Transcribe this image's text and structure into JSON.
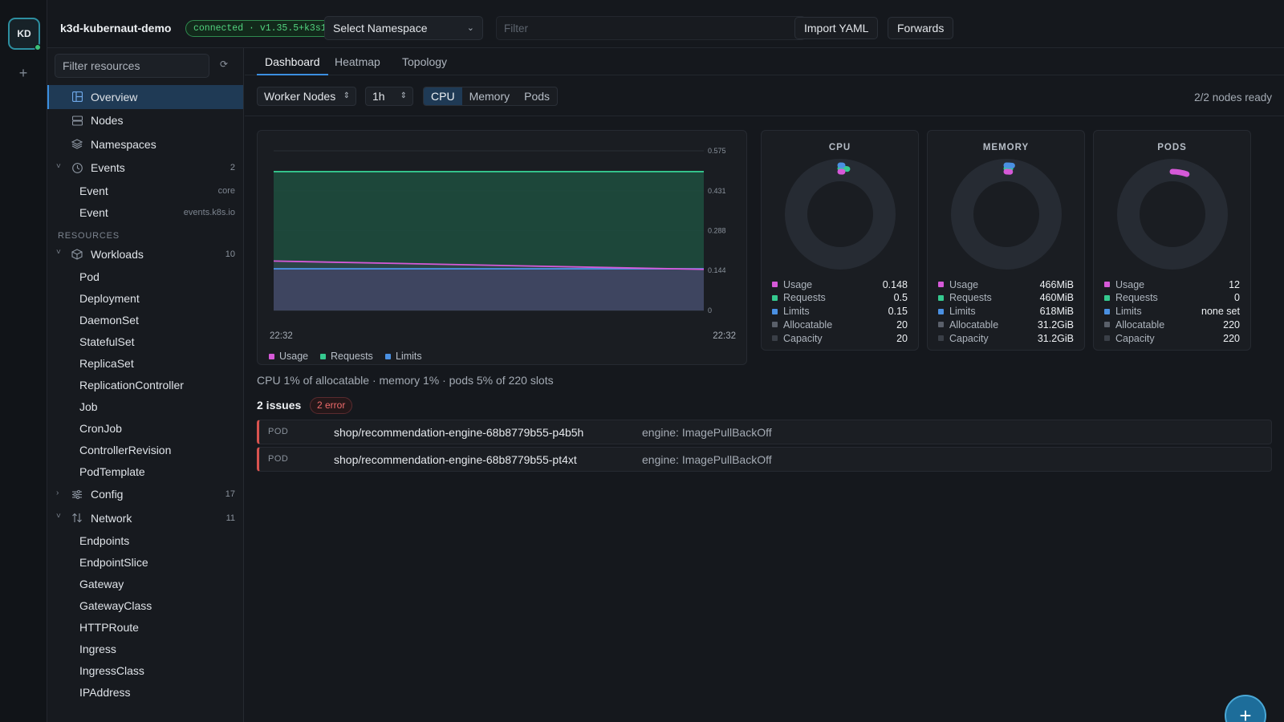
{
  "window": {
    "controls": [
      "close",
      "minimize",
      "maximize"
    ]
  },
  "rail": {
    "avatar_initials": "KD",
    "add_label": "+"
  },
  "topbar": {
    "cluster_name": "k3d-kubernaut-demo",
    "status_badge": "connected · v1.35.5+k3s1",
    "namespace_select": "Select Namespace",
    "filter_placeholder": "Filter",
    "import_label": "Import YAML",
    "forwards_label": "Forwards"
  },
  "sidebar": {
    "filter_placeholder": "Filter resources",
    "refresh_icon": "refresh-icon",
    "items": [
      {
        "label": "Overview",
        "icon": "grid-icon",
        "active": true
      },
      {
        "label": "Nodes",
        "icon": "server-icon"
      },
      {
        "label": "Namespaces",
        "icon": "layers-icon"
      },
      {
        "label": "Events",
        "icon": "clock-icon",
        "count": "2",
        "expanded": true,
        "children": [
          {
            "label": "Event",
            "tag": "core"
          },
          {
            "label": "Event",
            "tag": "events.k8s.io"
          }
        ]
      }
    ],
    "section_label": "RESOURCES",
    "groups": [
      {
        "label": "Workloads",
        "icon": "cube-icon",
        "count": "10",
        "expanded": true,
        "children": [
          "Pod",
          "Deployment",
          "DaemonSet",
          "StatefulSet",
          "ReplicaSet",
          "ReplicationController",
          "Job",
          "CronJob",
          "ControllerRevision",
          "PodTemplate"
        ]
      },
      {
        "label": "Config",
        "icon": "sliders-icon",
        "count": "17",
        "expanded": false,
        "children": []
      },
      {
        "label": "Network",
        "icon": "arrows-icon",
        "count": "11",
        "expanded": true,
        "children": [
          "Endpoints",
          "EndpointSlice",
          "Gateway",
          "GatewayClass",
          "HTTPRoute",
          "Ingress",
          "IngressClass",
          "IPAddress"
        ]
      }
    ]
  },
  "tabs": [
    "Dashboard",
    "Heatmap",
    "Topology"
  ],
  "active_tab": "Dashboard",
  "toolbar": {
    "node_select": "Worker Nodes",
    "range_select": "1h",
    "metric_tabs": [
      "CPU",
      "Memory",
      "Pods"
    ],
    "active_metric": "CPU",
    "ready_status": "2/2 nodes ready"
  },
  "colors": {
    "usage": "#d659d8",
    "requests": "#35c98f",
    "limits": "#4a90e2",
    "allocatable": "#5a606a",
    "capacity": "#3a3f47",
    "accent": "#3b8fe0",
    "error": "#d9534f"
  },
  "chart_data": {
    "type": "area",
    "x": [
      "22:32",
      "22:32"
    ],
    "ylim": [
      0,
      0.575
    ],
    "yticks": [
      "0",
      "0.144",
      "0.288",
      "0.431",
      "0.575"
    ],
    "series": [
      {
        "name": "Usage",
        "values": [
          0.178,
          0.148
        ]
      },
      {
        "name": "Requests",
        "values": [
          0.5,
          0.5
        ]
      },
      {
        "name": "Limits",
        "values": [
          0.15,
          0.15
        ]
      }
    ],
    "legend": [
      "Usage",
      "Requests",
      "Limits"
    ],
    "grid": true,
    "legend_position": "bottom-left"
  },
  "donuts": [
    {
      "title": "CPU",
      "usage_fraction": 0.0074,
      "requests_fraction": 0.025,
      "limits_fraction": 0.0075,
      "rows": [
        {
          "label": "Usage",
          "value": "0.148"
        },
        {
          "label": "Requests",
          "value": "0.5"
        },
        {
          "label": "Limits",
          "value": "0.15"
        },
        {
          "label": "Allocatable",
          "value": "20"
        },
        {
          "label": "Capacity",
          "value": "20"
        }
      ]
    },
    {
      "title": "MEMORY",
      "usage_fraction": 0.0146,
      "requests_fraction": 0.0144,
      "limits_fraction": 0.0193,
      "rows": [
        {
          "label": "Usage",
          "value": "466MiB"
        },
        {
          "label": "Requests",
          "value": "460MiB"
        },
        {
          "label": "Limits",
          "value": "618MiB"
        },
        {
          "label": "Allocatable",
          "value": "31.2GiB"
        },
        {
          "label": "Capacity",
          "value": "31.2GiB"
        }
      ]
    },
    {
      "title": "PODS",
      "usage_fraction": 0.0545,
      "requests_fraction": 0,
      "limits_fraction": 0,
      "rows": [
        {
          "label": "Usage",
          "value": "12"
        },
        {
          "label": "Requests",
          "value": "0"
        },
        {
          "label": "Limits",
          "value": "none set"
        },
        {
          "label": "Allocatable",
          "value": "220"
        },
        {
          "label": "Capacity",
          "value": "220"
        }
      ]
    }
  ],
  "summary": "CPU 1% of allocatable · memory 1% · pods 5% of 220 slots",
  "issues": {
    "title": "2 issues",
    "badge": "2 error",
    "rows": [
      {
        "kind": "POD",
        "name": "shop/recommendation-engine-68b8779b55-p4b5h",
        "reason": "engine: ImagePullBackOff"
      },
      {
        "kind": "POD",
        "name": "shop/recommendation-engine-68b8779b55-pt4xt",
        "reason": "engine: ImagePullBackOff"
      }
    ]
  },
  "fab_label": "+"
}
